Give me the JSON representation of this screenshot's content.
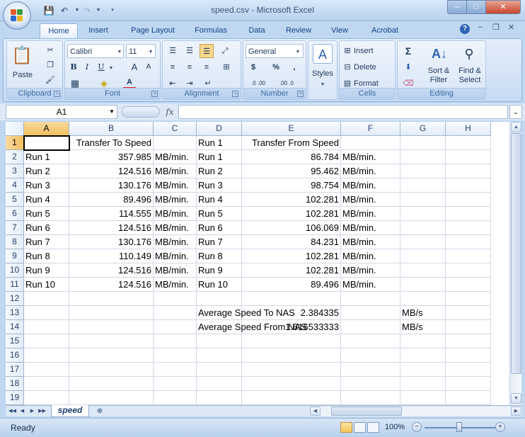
{
  "window": {
    "title": "speed.csv - Microsoft Excel",
    "min": "–",
    "max": "□",
    "close": "✕",
    "restore": "❐"
  },
  "ribbon_tabs": [
    "Home",
    "Insert",
    "Page Layout",
    "Formulas",
    "Data",
    "Review",
    "View",
    "Acrobat"
  ],
  "ribbon": {
    "clipboard": {
      "label": "Clipboard",
      "paste": "Paste"
    },
    "font": {
      "label": "Font",
      "name": "Calibri",
      "size": "11",
      "bold": "B",
      "italic": "I",
      "underline": "U",
      "grow": "A",
      "shrink": "A",
      "color_letter": "A"
    },
    "alignment": {
      "label": "Alignment"
    },
    "number": {
      "label": "Number",
      "format": "General",
      "currency": "$",
      "percent": "%",
      "comma": ",",
      "inc": ".0 .00",
      "dec": ".00 .0"
    },
    "styles": {
      "label": "Styles"
    },
    "cells": {
      "label": "Cells",
      "insert": "Insert",
      "delete": "Delete",
      "format": "Format"
    },
    "editing": {
      "label": "Editing",
      "sort": "Sort &\nFilter",
      "find": "Find &\nSelect",
      "sigma": "Σ"
    }
  },
  "formula_bar": {
    "name_box": "A1",
    "fx": "fx",
    "formula": ""
  },
  "columns": [
    "A",
    "B",
    "C",
    "D",
    "E",
    "F",
    "G",
    "H"
  ],
  "selected_cell": "A1",
  "rows": [
    {
      "n": "1",
      "A": "",
      "B": "Transfer To Speed",
      "C": "",
      "D": "Run 1",
      "E": "Transfer From Speed",
      "F": "",
      "G": ""
    },
    {
      "n": "2",
      "A": "Run 1",
      "B": "357.985",
      "C": "MB/min.",
      "D": "Run 1",
      "E": "86.784",
      "F": "MB/min.",
      "G": ""
    },
    {
      "n": "3",
      "A": "Run 2",
      "B": "124.516",
      "C": "MB/min.",
      "D": "Run 2",
      "E": "95.462",
      "F": "MB/min.",
      "G": ""
    },
    {
      "n": "4",
      "A": "Run 3",
      "B": "130.176",
      "C": "MB/min.",
      "D": "Run 3",
      "E": "98.754",
      "F": "MB/min.",
      "G": ""
    },
    {
      "n": "5",
      "A": "Run 4",
      "B": "89.496",
      "C": "MB/min.",
      "D": "Run 4",
      "E": "102.281",
      "F": "MB/min.",
      "G": ""
    },
    {
      "n": "6",
      "A": "Run 5",
      "B": "114.555",
      "C": "MB/min.",
      "D": "Run 5",
      "E": "102.281",
      "F": "MB/min.",
      "G": ""
    },
    {
      "n": "7",
      "A": "Run 6",
      "B": "124.516",
      "C": "MB/min.",
      "D": "Run 6",
      "E": "106.069",
      "F": "MB/min.",
      "G": ""
    },
    {
      "n": "8",
      "A": "Run 7",
      "B": "130.176",
      "C": "MB/min.",
      "D": "Run 7",
      "E": "84.231",
      "F": "MB/min.",
      "G": ""
    },
    {
      "n": "9",
      "A": "Run 8",
      "B": "110.149",
      "C": "MB/min.",
      "D": "Run 8",
      "E": "102.281",
      "F": "MB/min.",
      "G": ""
    },
    {
      "n": "10",
      "A": "Run 9",
      "B": "124.516",
      "C": "MB/min.",
      "D": "Run 9",
      "E": "102.281",
      "F": "MB/min.",
      "G": ""
    },
    {
      "n": "11",
      "A": "Run 10",
      "B": "124.516",
      "C": "MB/min.",
      "D": "Run 10",
      "E": "89.496",
      "F": "MB/min.",
      "G": ""
    },
    {
      "n": "12",
      "A": "",
      "B": "",
      "C": "",
      "D": "",
      "E": "",
      "F": "",
      "G": ""
    },
    {
      "n": "13",
      "A": "",
      "B": "",
      "C": "",
      "D": "Average Speed To NAS",
      "E": "2.384335",
      "F": "",
      "G": "MB/s"
    },
    {
      "n": "14",
      "A": "",
      "B": "",
      "C": "",
      "D": "Average Speed From NAS",
      "E": "1.616533333",
      "F": "",
      "G": "MB/s"
    },
    {
      "n": "15",
      "A": "",
      "B": "",
      "C": "",
      "D": "",
      "E": "",
      "F": "",
      "G": ""
    },
    {
      "n": "16",
      "A": "",
      "B": "",
      "C": "",
      "D": "",
      "E": "",
      "F": "",
      "G": ""
    },
    {
      "n": "17",
      "A": "",
      "B": "",
      "C": "",
      "D": "",
      "E": "",
      "F": "",
      "G": ""
    },
    {
      "n": "18",
      "A": "",
      "B": "",
      "C": "",
      "D": "",
      "E": "",
      "F": "",
      "G": ""
    },
    {
      "n": "19",
      "A": "",
      "B": "",
      "C": "",
      "D": "",
      "E": "",
      "F": "",
      "G": ""
    }
  ],
  "sheet_tabs": [
    "speed"
  ],
  "status": {
    "text": "Ready",
    "zoom": "100%"
  },
  "colors": {
    "accent": "#15428b",
    "selected_header": "#f1c15f",
    "grid_line": "#d0d7e5"
  }
}
